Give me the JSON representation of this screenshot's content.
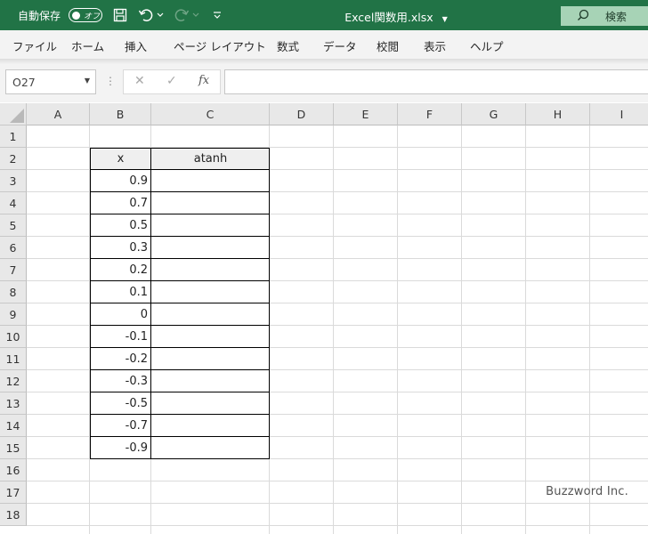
{
  "titlebar": {
    "autosave_label": "自動保存",
    "autosave_state": "オフ",
    "filename": "Excel関数用.xlsx",
    "search_label": "検索"
  },
  "menu": {
    "items": [
      "ファイル",
      "ホーム",
      "挿入",
      "ページ レイアウト",
      "数式",
      "データ",
      "校閲",
      "表示",
      "ヘルプ"
    ]
  },
  "formula_bar": {
    "name_box": "O27",
    "fx_label": "fx",
    "formula": ""
  },
  "sheet": {
    "columns": [
      "A",
      "B",
      "C",
      "D",
      "E",
      "F",
      "G",
      "H",
      "I"
    ],
    "rows": [
      "1",
      "2",
      "3",
      "4",
      "5",
      "6",
      "7",
      "8",
      "9",
      "10",
      "11",
      "12",
      "13",
      "14",
      "15",
      "16",
      "17",
      "18"
    ],
    "table_header": {
      "x": "x",
      "atanh": "atanh"
    },
    "x_values": [
      "0.9",
      "0.7",
      "0.5",
      "0.3",
      "0.2",
      "0.1",
      "0",
      "-0.1",
      "-0.2",
      "-0.3",
      "-0.5",
      "-0.7",
      "-0.9"
    ]
  },
  "watermark": "Buzzword Inc.",
  "colors": {
    "titlebar": "#217346",
    "search_box": "#a7d3b6",
    "header_bg": "#e8e8e8"
  }
}
